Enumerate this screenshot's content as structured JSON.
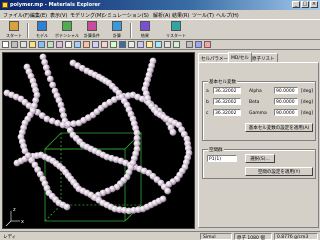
{
  "window": {
    "title": "polymer.mp - Materials Explorer",
    "buttons": [
      "_",
      "□",
      "×"
    ]
  },
  "menu": [
    "ファイル(F)",
    "編集(E)",
    "表示(V)",
    "モデリング(M)",
    "シミュレーション(S)",
    "解析(A)",
    "結果(R)",
    "ツール(T)",
    "ヘルプ(H)"
  ],
  "toolbar_big": [
    {
      "label": "スタート",
      "icon": "start-icon",
      "color": "#d9a23a"
    },
    {
      "label": "モデル",
      "icon": "model-icon",
      "color": "#2f7fd4"
    },
    {
      "label": "ポテンシャル",
      "icon": "potential-icon",
      "color": "#4fae4f"
    },
    {
      "label": "計算条件",
      "icon": "conditions-icon",
      "color": "#c84b9e"
    },
    {
      "label": "計算",
      "icon": "calculate-icon",
      "color": "#3a9ad9"
    },
    {
      "label": "結果",
      "icon": "result-icon",
      "color": "#7a4fd6"
    },
    {
      "label": "リスタート",
      "icon": "restart-icon",
      "color": "#2fa5a5"
    }
  ],
  "panel": {
    "tabs": [
      "セルパラメータ",
      "MD/セル",
      "原子リスト"
    ],
    "group_cell_title": "基本セル変数",
    "cell_params": [
      {
        "label": "a",
        "value": "36.32002",
        "angle_label": "Alpha",
        "angle": "90.0000",
        "unit": "[deg]"
      },
      {
        "label": "b",
        "value": "36.32002",
        "angle_label": "Beta",
        "angle": "90.0000",
        "unit": "[deg]"
      },
      {
        "label": "c",
        "value": "36.32002",
        "angle_label": "Gamma",
        "angle": "90.0000",
        "unit": "[deg]"
      }
    ],
    "apply_cell_button": "基本セル変数の設定を適用(A)",
    "group_space_title": "空間群",
    "space_group_value": "P1(1)",
    "space_group_button": "選択(S)...",
    "apply_space_button": "空間の設定を適用(Y)"
  },
  "status": {
    "left": "レディ",
    "mode": "Simul",
    "atoms": "原子 1080 個",
    "density": "0.8776 g/cm3"
  },
  "colors": {
    "titlebar": "#0a246a",
    "chain": "#d8c8d8",
    "box": "#33aa33"
  }
}
